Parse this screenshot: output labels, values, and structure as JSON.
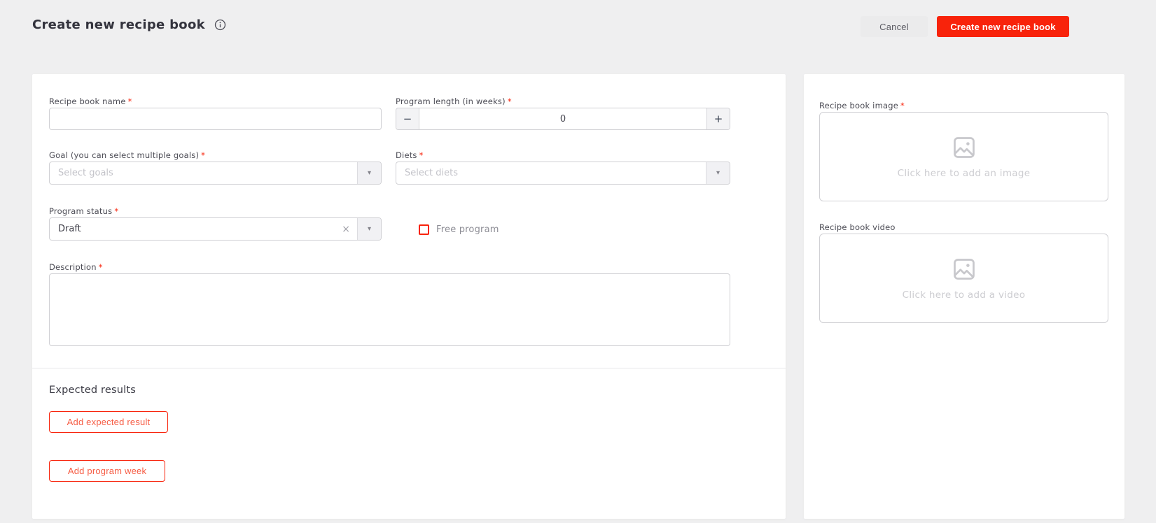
{
  "header": {
    "title": "Create new recipe book",
    "buttons": {
      "cancel": "Cancel",
      "submit": "Create new recipe book"
    }
  },
  "icons": {
    "minus": "−",
    "plus": "+",
    "caret": "▾",
    "clear": "×"
  },
  "form": {
    "recipe_book_name": {
      "label": "Recipe book name",
      "required": "*",
      "value": ""
    },
    "program_length": {
      "label": "Program length (in weeks)",
      "required": "*",
      "value": "0"
    },
    "goal": {
      "label": "Goal (you can select multiple goals)",
      "required": "*",
      "placeholder": "Select goals"
    },
    "diets": {
      "label": "Diets",
      "required": "*",
      "placeholder": "Select diets"
    },
    "program_status": {
      "label": "Program status",
      "required": "*",
      "value": "Draft"
    },
    "free_program": {
      "label": "Free program",
      "checked": false
    },
    "description": {
      "label": "Description",
      "required": "*",
      "value": ""
    }
  },
  "sections": {
    "expected_results": {
      "heading": "Expected results",
      "add_expected_result": "Add expected result",
      "add_program_week": "Add program week"
    }
  },
  "media": {
    "image": {
      "label": "Recipe book image",
      "required": "*",
      "placeholder": "Click here to add an image"
    },
    "video": {
      "label": "Recipe book video",
      "required": "",
      "placeholder": "Click here to add a video"
    }
  },
  "colors": {
    "accent": "#f8230b",
    "page_bg": "#efeff0",
    "card_bg": "#ffffff"
  }
}
